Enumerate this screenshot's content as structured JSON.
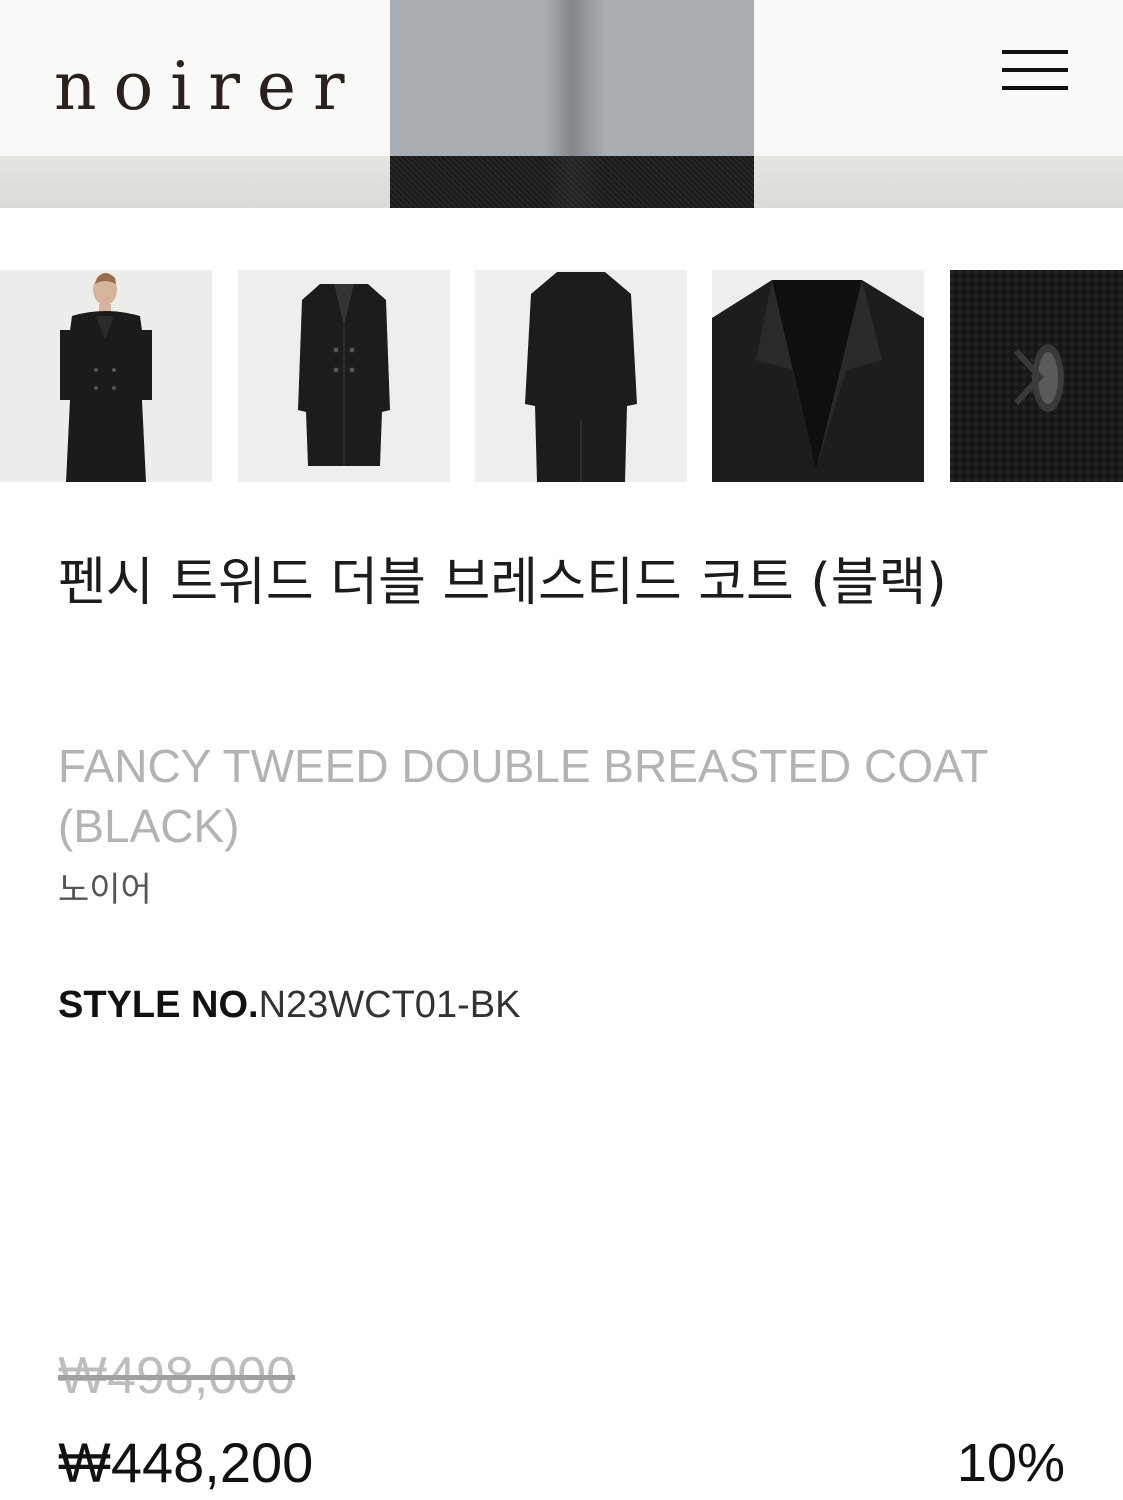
{
  "header": {
    "logo_text": "noirer",
    "menu_icon": "hamburger-menu-icon"
  },
  "gallery": {
    "thumbnails": [
      {
        "name": "model-wearing-coat",
        "variant": "light"
      },
      {
        "name": "coat-front",
        "variant": "light"
      },
      {
        "name": "coat-back",
        "variant": "light"
      },
      {
        "name": "coat-collar-detail",
        "variant": "light"
      },
      {
        "name": "coat-button-detail",
        "variant": "dark"
      }
    ],
    "next_icon": "chevron-right-icon"
  },
  "product": {
    "title_ko": "펜시 트위드 더블 브레스티드 코트 (블랙)",
    "title_en": "FANCY TWEED DOUBLE BREASTED COAT (BLACK)",
    "brand": "노이어",
    "style_label": "STYLE NO.",
    "style_value": "N23WCT01-BK"
  },
  "pricing": {
    "original_price": "₩498,000",
    "sale_price": "₩448,200",
    "discount": "10%"
  },
  "colors": {
    "text": "#1c1c1c",
    "muted": "#b3b3b3",
    "coat": "#1b1b1b"
  }
}
